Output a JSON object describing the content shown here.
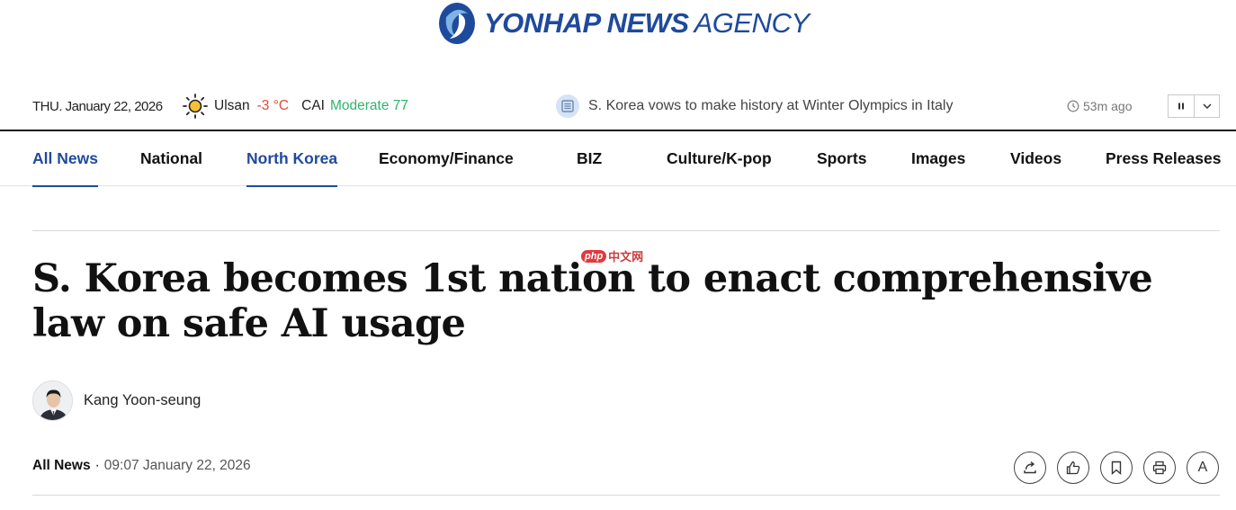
{
  "brand": {
    "name_bold": "YONHAP NEWS",
    "name_light": "AGENCY",
    "logo_color": "#1f4a9c"
  },
  "infobar": {
    "date": "THU. January 22, 2026",
    "weather": {
      "icon": "sun-icon",
      "city": "Ulsan",
      "temperature": "-3 °C",
      "cai_label": "CAI",
      "cai_value": "Moderate 77"
    },
    "ticker": {
      "icon": "news-icon",
      "headline": "S. Korea vows to make history at Winter Olympics in Italy",
      "time_icon": "clock-icon",
      "time": "53m ago",
      "pause_icon": "pause-icon",
      "expand_icon": "chevron-down-icon"
    }
  },
  "nav": {
    "items": [
      {
        "label": "All News",
        "active": true
      },
      {
        "label": "National",
        "active": false
      },
      {
        "label": "North Korea",
        "active": true
      },
      {
        "label": "Economy/Finance",
        "active": false
      },
      {
        "label": "BIZ",
        "active": false
      },
      {
        "label": "Culture/K-pop",
        "active": false
      },
      {
        "label": "Sports",
        "active": false
      },
      {
        "label": "Images",
        "active": false
      },
      {
        "label": "Videos",
        "active": false
      },
      {
        "label": "Press Releases",
        "active": false
      }
    ]
  },
  "watermark": {
    "badge": "php",
    "text": "中文网"
  },
  "article": {
    "headline": "S. Korea becomes 1st nation to enact comprehensive law on safe AI usage",
    "author": "Kang Yoon-seung",
    "section": "All News",
    "separator": "·",
    "timestamp": "09:07 January 22, 2026",
    "tools": [
      "share-icon",
      "like-icon",
      "bookmark-icon",
      "print-icon",
      "font-size-icon"
    ],
    "font_tool_label": "A"
  },
  "colors": {
    "accent": "#1f4a9c",
    "temperature": "#e2483b",
    "cai": "#2db56d"
  }
}
